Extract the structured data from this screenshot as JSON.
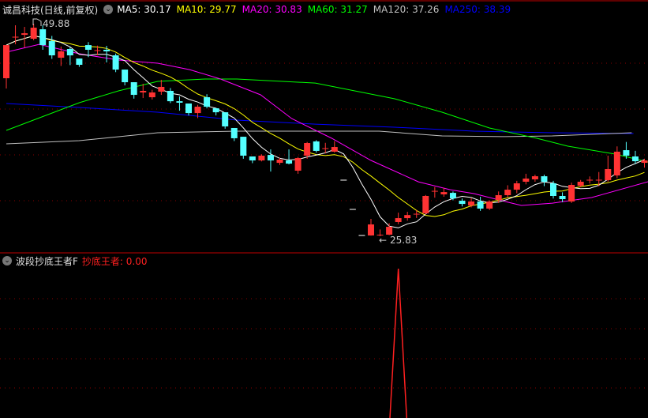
{
  "header": {
    "stock_name": "诚昌科技(日线,前复权)",
    "ma_labels": [
      {
        "text": "MA5: 30.17",
        "color": "#ffffff"
      },
      {
        "text": "MA10: 29.77",
        "color": "#ffff00"
      },
      {
        "text": "MA20: 30.83",
        "color": "#ff00ff"
      },
      {
        "text": "MA60: 31.27",
        "color": "#00ff00"
      },
      {
        "text": "MA120: 37.26",
        "color": "#c0c0c0"
      },
      {
        "text": "MA250: 38.39",
        "color": "#0000ff"
      }
    ],
    "toggle_icon": "chevron-down-icon"
  },
  "annotations": {
    "high_label": "49.88",
    "low_label": "25.83",
    "low_arrow": "←"
  },
  "sub_panel": {
    "indicator_name": "波段抄底王者F",
    "value_label": "抄底王者: 0.00",
    "value_color": "#ff2020"
  },
  "colors": {
    "up": "#ff3333",
    "down": "#54ffff",
    "grid": "#8b0000",
    "separator": "#c00000"
  },
  "chart_data": {
    "type": "candlestick",
    "price_range": [
      25.83,
      49.88
    ],
    "candles": [
      [
        43.71,
        47.46,
        42.55,
        47.46
      ],
      [
        48.36,
        49.7,
        47.55,
        48.36
      ],
      [
        48.62,
        49.52,
        47.2,
        48.8
      ],
      [
        48.18,
        49.88,
        48.0,
        49.43
      ],
      [
        49.25,
        49.7,
        46.93,
        47.46
      ],
      [
        47.91,
        48.5,
        45.9,
        46.3
      ],
      [
        46.03,
        47.3,
        45.1,
        46.75
      ],
      [
        47.02,
        47.2,
        45.2,
        46.3
      ],
      [
        45.94,
        45.94,
        45.0,
        45.23
      ],
      [
        47.46,
        47.8,
        46.1,
        46.93
      ],
      [
        46.84,
        47.4,
        46.3,
        46.84
      ],
      [
        46.93,
        47.37,
        45.5,
        46.75
      ],
      [
        46.3,
        46.5,
        44.4,
        44.69
      ],
      [
        44.69,
        44.69,
        42.9,
        43.26
      ],
      [
        43.26,
        43.26,
        41.4,
        41.83
      ],
      [
        42.1,
        43.08,
        41.47,
        42.28
      ],
      [
        41.56,
        42.4,
        41.3,
        42.1
      ],
      [
        42.19,
        43.53,
        41.83,
        42.73
      ],
      [
        42.28,
        42.6,
        40.9,
        41.11
      ],
      [
        41.11,
        41.65,
        40.04,
        40.94
      ],
      [
        40.85,
        40.85,
        39.5,
        39.77
      ],
      [
        39.77,
        40.7,
        39.2,
        40.49
      ],
      [
        41.56,
        41.9,
        40.3,
        40.49
      ],
      [
        40.31,
        40.31,
        39.5,
        39.86
      ],
      [
        39.86,
        39.86,
        38.0,
        38.26
      ],
      [
        38.08,
        38.08,
        36.6,
        36.92
      ],
      [
        37.09,
        37.09,
        34.6,
        34.95
      ],
      [
        34.86,
        34.86,
        34.1,
        34.41
      ],
      [
        34.41,
        35.1,
        34.3,
        34.95
      ],
      [
        35.03,
        35.66,
        33.15,
        34.41
      ],
      [
        34.14,
        34.7,
        33.9,
        34.5
      ],
      [
        34.41,
        35.66,
        33.96,
        34.05
      ],
      [
        33.25,
        34.8,
        32.9,
        34.68
      ],
      [
        34.95,
        36.5,
        34.6,
        36.38
      ],
      [
        36.56,
        36.7,
        35.3,
        35.49
      ],
      [
        35.75,
        36.4,
        35.2,
        35.75
      ],
      [
        35.4,
        36.6,
        35.3,
        35.93
      ],
      [
        32.18,
        32.18,
        32.18,
        32.18
      ],
      [
        28.87,
        28.87,
        28.87,
        28.87
      ],
      [
        25.92,
        25.92,
        25.92,
        25.92
      ],
      [
        25.92,
        27.8,
        25.9,
        27.17
      ],
      [
        25.92,
        26.6,
        25.83,
        26.01
      ],
      [
        26.01,
        27.3,
        25.95,
        26.9
      ],
      [
        27.44,
        28.5,
        27.2,
        27.88
      ],
      [
        27.88,
        28.6,
        27.6,
        28.23
      ],
      [
        28.33,
        28.8,
        27.9,
        28.33
      ],
      [
        28.42,
        30.5,
        28.3,
        30.39
      ],
      [
        30.92,
        31.4,
        30.2,
        30.92
      ],
      [
        30.57,
        31.3,
        30.3,
        30.83
      ],
      [
        30.74,
        30.9,
        29.9,
        30.11
      ],
      [
        29.85,
        30.1,
        29.2,
        29.49
      ],
      [
        29.31,
        30.2,
        29.1,
        29.76
      ],
      [
        29.76,
        30.3,
        28.7,
        28.96
      ],
      [
        28.96,
        29.9,
        28.8,
        29.76
      ],
      [
        29.94,
        30.9,
        29.6,
        30.48
      ],
      [
        30.48,
        31.6,
        30.2,
        31.1
      ],
      [
        31.1,
        32.1,
        30.7,
        31.82
      ],
      [
        32.0,
        32.9,
        31.7,
        32.36
      ],
      [
        32.27,
        32.8,
        32.0,
        32.62
      ],
      [
        32.62,
        32.8,
        31.5,
        32.0
      ],
      [
        31.82,
        32.1,
        30.1,
        30.39
      ],
      [
        30.39,
        30.8,
        29.7,
        30.03
      ],
      [
        29.76,
        31.9,
        29.6,
        31.64
      ],
      [
        31.55,
        32.2,
        31.4,
        32.0
      ],
      [
        32.18,
        32.6,
        31.8,
        32.18
      ],
      [
        32.18,
        33.1,
        31.5,
        32.18
      ],
      [
        32.18,
        34.95,
        32.0,
        33.43
      ],
      [
        32.71,
        36.0,
        32.4,
        35.4
      ],
      [
        35.57,
        36.5,
        34.6,
        34.95
      ],
      [
        34.86,
        35.5,
        34.0,
        34.32
      ],
      [
        34.14,
        34.6,
        33.6,
        34.41
      ]
    ],
    "ma_lines": {
      "ma20": [
        [
          0,
          46.66
        ],
        [
          3.6,
          47.55
        ],
        [
          8,
          46.48
        ],
        [
          12.3,
          45.77
        ],
        [
          16.6,
          45.41
        ],
        [
          20.1,
          44.69
        ],
        [
          23.5,
          43.62
        ],
        [
          27.9,
          41.83
        ],
        [
          31.3,
          39.15
        ],
        [
          35.7,
          36.92
        ],
        [
          40,
          34.41
        ],
        [
          45.2,
          31.99
        ],
        [
          48.7,
          31.1
        ],
        [
          51.3,
          30.66
        ],
        [
          54.7,
          29.76
        ],
        [
          56.5,
          29.32
        ],
        [
          59.9,
          29.58
        ],
        [
          64.2,
          30.21
        ],
        [
          70.4,
          32.0
        ]
      ],
      "ma60": [
        [
          0,
          37.81
        ],
        [
          8,
          40.94
        ],
        [
          12.3,
          42.28
        ],
        [
          16.6,
          43.35
        ],
        [
          21.8,
          43.62
        ],
        [
          25.3,
          43.62
        ],
        [
          33.9,
          43.17
        ],
        [
          42.6,
          41.39
        ],
        [
          47.8,
          39.87
        ],
        [
          53,
          38.08
        ],
        [
          58.2,
          36.92
        ],
        [
          61.6,
          36.02
        ],
        [
          66.8,
          35.13
        ],
        [
          70.4,
          34.23
        ]
      ],
      "ma120": [
        [
          0,
          36.29
        ],
        [
          8,
          36.65
        ],
        [
          16.6,
          37.54
        ],
        [
          25.3,
          37.72
        ],
        [
          33.9,
          37.72
        ],
        [
          40.9,
          37.72
        ],
        [
          47.8,
          37.18
        ],
        [
          54.7,
          37.1
        ],
        [
          59.9,
          37.18
        ],
        [
          68.6,
          37.54
        ]
      ],
      "ma250": [
        [
          0,
          40.85
        ],
        [
          8,
          40.4
        ],
        [
          16.6,
          39.87
        ],
        [
          25.3,
          38.97
        ],
        [
          33.9,
          38.52
        ],
        [
          42.6,
          38.17
        ],
        [
          51.3,
          37.72
        ],
        [
          59.9,
          37.54
        ],
        [
          68.8,
          37.45
        ]
      ]
    },
    "indicator": {
      "name": "抄底王者",
      "points": [
        [
          41,
          0
        ],
        [
          42,
          0
        ],
        [
          43,
          100
        ],
        [
          44,
          0
        ],
        [
          45,
          0
        ]
      ],
      "range": [
        0,
        100
      ]
    }
  }
}
